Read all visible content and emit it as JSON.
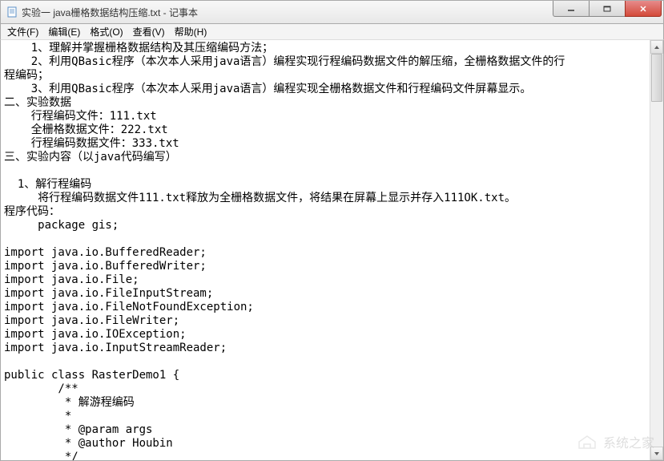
{
  "window": {
    "title": "实验一 java栅格数据结构压缩.txt - 记事本"
  },
  "menu": {
    "file": "文件(F)",
    "edit": "编辑(E)",
    "format": "格式(O)",
    "view": "查看(V)",
    "help": "帮助(H)"
  },
  "content": "    1、理解并掌握栅格数据结构及其压缩编码方法；\n    2、利用QBasic程序（本次本人采用java语言）编程实现行程编码数据文件的解压缩，全栅格数据文件的行\n程编码；\n    3、利用QBasic程序（本次本人采用java语言）编程实现全栅格数据文件和行程编码文件屏幕显示。\n二、实验数据\n    行程编码文件：111.txt\n    全栅格数据文件：222.txt\n    行程编码数据文件：333.txt\n三、实验内容（以java代码编写）\n\n  1、解行程编码\n     将行程编码数据文件111.txt释放为全栅格数据文件，将结果在屏幕上显示并存入111OK.txt。\n程序代码：\n     package gis;\n\nimport java.io.BufferedReader;\nimport java.io.BufferedWriter;\nimport java.io.File;\nimport java.io.FileInputStream;\nimport java.io.FileNotFoundException;\nimport java.io.FileWriter;\nimport java.io.IOException;\nimport java.io.InputStreamReader;\n\npublic class RasterDemo1 {\n        /**\n         * 解游程编码\n         *\n         * @param args\n         * @author Houbin\n         */",
  "watermark": "系统之家"
}
